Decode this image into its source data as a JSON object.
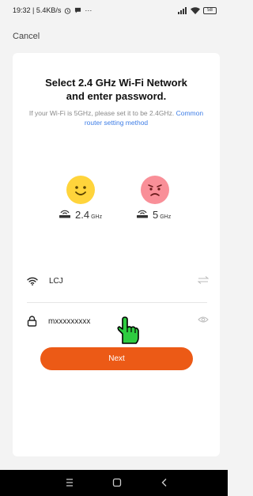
{
  "status_bar": {
    "time_speed": "19:32 | 5.4KB/s",
    "extra": "···",
    "battery": "58"
  },
  "cancel_label": "Cancel",
  "title": "Select 2.4 GHz Wi-Fi Network\nand enter password.",
  "hint": {
    "text": "If your Wi-Fi is 5GHz, please set it to be 2.4GHz.",
    "link": "Common router setting method"
  },
  "bands": [
    {
      "value": "2.4",
      "unit": "GHz",
      "status": "supported"
    },
    {
      "value": "5",
      "unit": "GHz",
      "status": "unsupported"
    }
  ],
  "ssid": "LCJ",
  "password": "mxxxxxxxxx",
  "next_label": "Next",
  "colors": {
    "accent": "#ec5a16",
    "link": "#3d7de6",
    "ok_face": "#ffd43b",
    "bad_face": "#f98f98",
    "cursor": "#2ecc40"
  }
}
